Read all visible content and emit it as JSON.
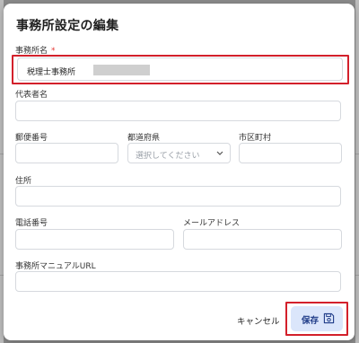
{
  "dialog": {
    "title": "事務所設定の編集"
  },
  "fields": {
    "office_name": {
      "label": "事務所名",
      "required_mark": "*",
      "value": "税理士事務所"
    },
    "representative": {
      "label": "代表者名",
      "value": ""
    },
    "postal_code": {
      "label": "郵便番号",
      "value": ""
    },
    "prefecture": {
      "label": "都道府県",
      "placeholder": "選択してください"
    },
    "city": {
      "label": "市区町村",
      "value": ""
    },
    "address": {
      "label": "住所",
      "value": ""
    },
    "phone": {
      "label": "電話番号",
      "value": ""
    },
    "email": {
      "label": "メールアドレス",
      "value": ""
    },
    "manual_url": {
      "label": "事務所マニュアルURL",
      "value": ""
    }
  },
  "footer": {
    "cancel_label": "キャンセル",
    "save_label": "保存",
    "save_icon": "floppy-disk-icon"
  },
  "colors": {
    "highlight": "#d3202b",
    "required": "#e53935",
    "save_bg": "#dbe6fb",
    "save_text": "#1f3c88"
  }
}
